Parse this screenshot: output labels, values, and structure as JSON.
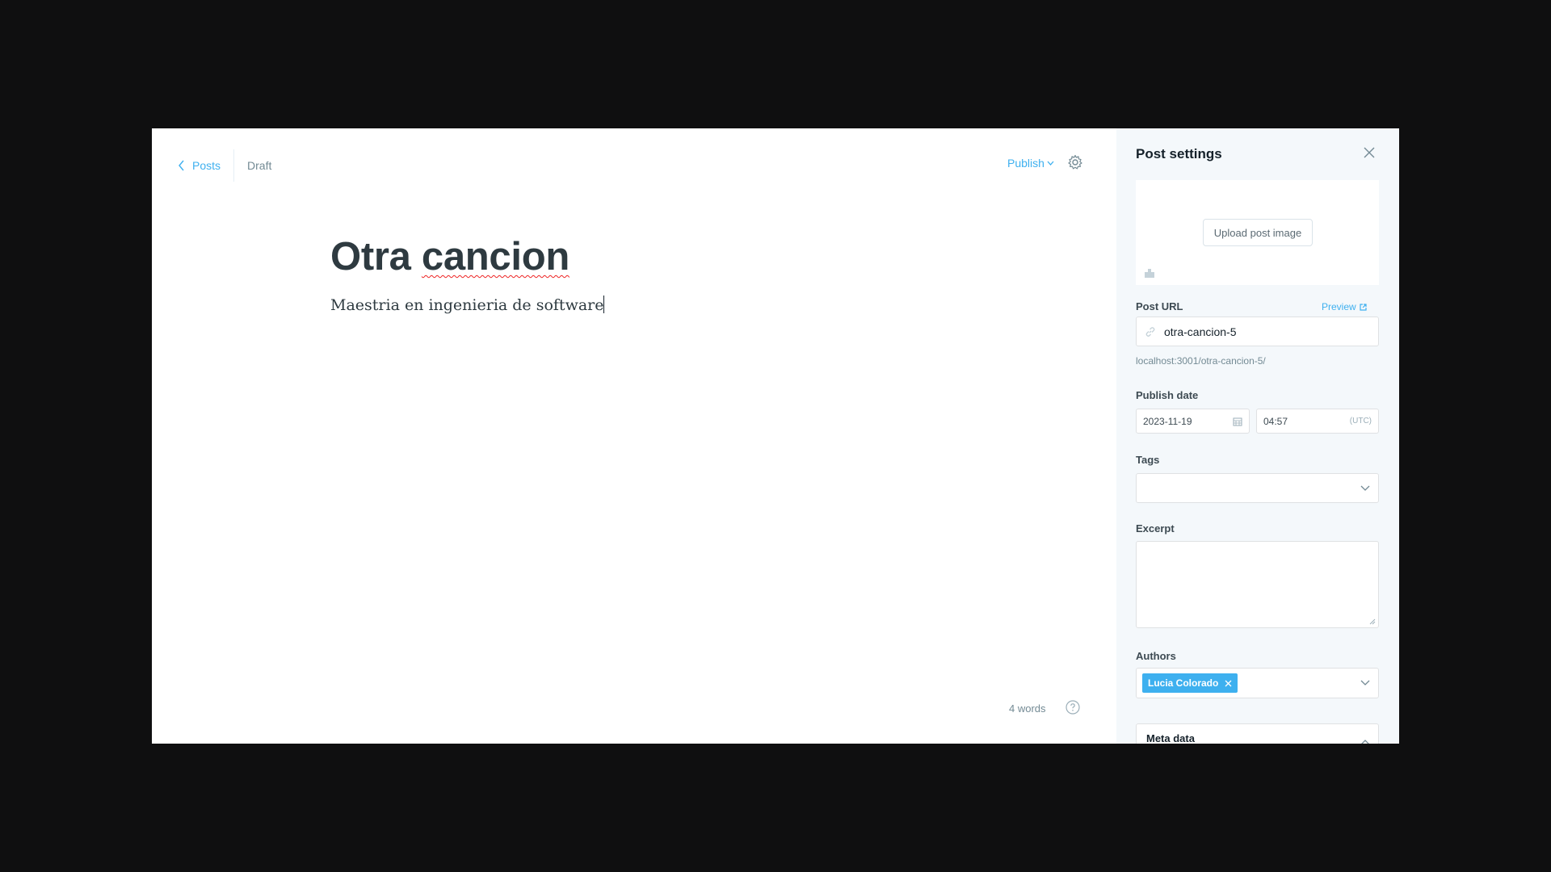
{
  "nav": {
    "back_label": "Posts",
    "status": "Draft",
    "publish_label": "Publish"
  },
  "post": {
    "title_word1": "Otra",
    "title_word2": "cancion",
    "body": "Maestria en ingenieria de software"
  },
  "footer": {
    "word_count": "4 words"
  },
  "settings": {
    "title": "Post settings",
    "upload_image_label": "Upload post image",
    "post_url_label": "Post URL",
    "preview_label": "Preview",
    "slug": "otra-cancion-5",
    "full_url": "localhost:3001/otra-cancion-5/",
    "publish_date_label": "Publish date",
    "date": "2023-11-19",
    "time": "04:57",
    "timezone": "(UTC)",
    "tags_label": "Tags",
    "excerpt_label": "Excerpt",
    "excerpt_value": "",
    "authors_label": "Authors",
    "authors": [
      "Lucia Colorado"
    ],
    "meta_label": "Meta data"
  },
  "colors": {
    "accent": "#3eb0ef",
    "panel_bg": "#f4f8fb",
    "backdrop": "#0f0f10"
  },
  "icons": [
    "chevron-left-icon",
    "chevron-down-icon",
    "gear-icon",
    "help-icon",
    "close-icon",
    "image-icon",
    "link-icon",
    "external-link-icon",
    "calendar-icon",
    "remove-icon"
  ]
}
